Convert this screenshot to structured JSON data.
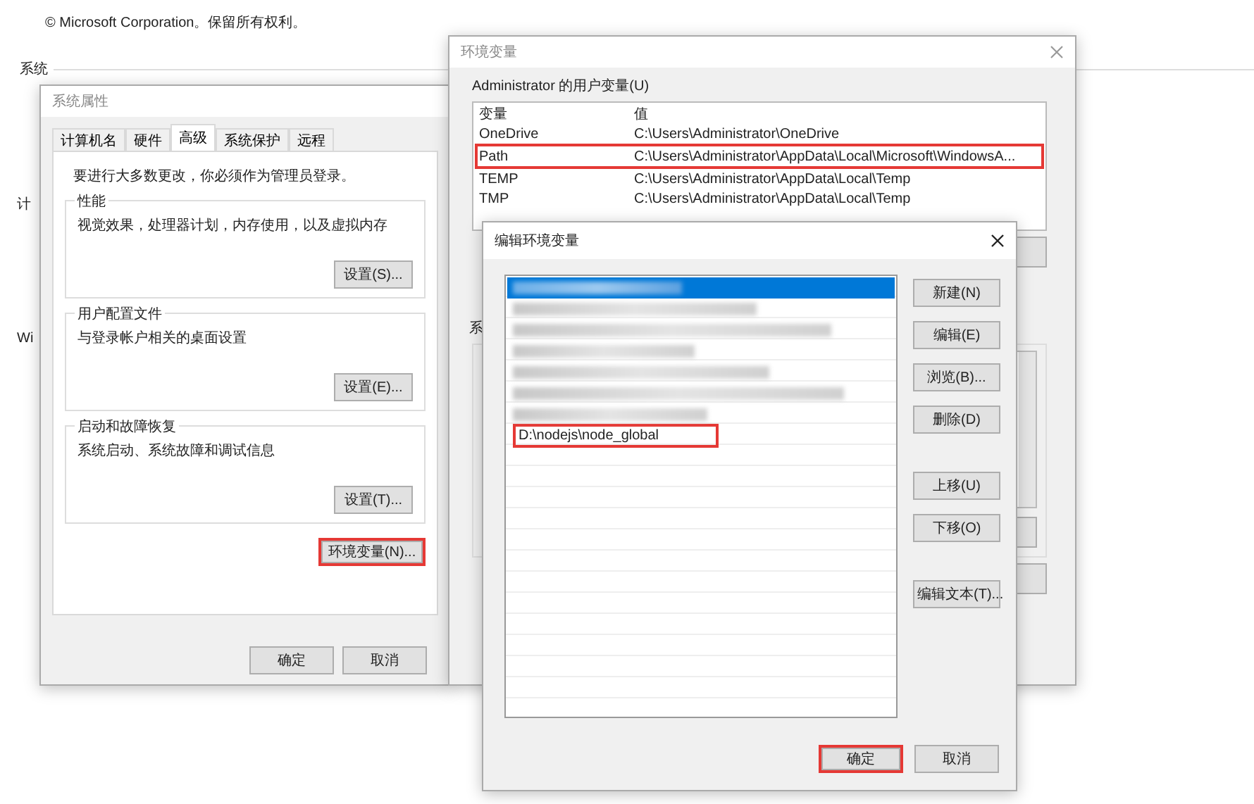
{
  "background": {
    "copyright": "© Microsoft Corporation。保留所有权利。",
    "section": "系统",
    "labels": [
      "计",
      "Wi"
    ]
  },
  "system_properties": {
    "title": "系统属性",
    "tabs": [
      {
        "label": "计算机名",
        "selected": false
      },
      {
        "label": "硬件",
        "selected": false
      },
      {
        "label": "高级",
        "selected": true
      },
      {
        "label": "系统保护",
        "selected": false
      },
      {
        "label": "远程",
        "selected": false
      }
    ],
    "notice": "要进行大多数更改，你必须作为管理员登录。",
    "groups": [
      {
        "title": "性能",
        "description": "视觉效果，处理器计划，内存使用，以及虚拟内存",
        "button": "设置(S)..."
      },
      {
        "title": "用户配置文件",
        "description": "与登录帐户相关的桌面设置",
        "button": "设置(E)..."
      },
      {
        "title": "启动和故障恢复",
        "description": "系统启动、系统故障和调试信息",
        "button": "设置(T)..."
      }
    ],
    "env_button": {
      "label": "环境变量(N)...",
      "highlighted": true
    },
    "buttons": [
      "确定",
      "取消"
    ]
  },
  "env_vars": {
    "title": "环境变量",
    "user_section": "Administrator 的用户变量(U)",
    "columns": [
      "变量",
      "值"
    ],
    "rows": [
      {
        "name": "OneDrive",
        "value": "C:\\Users\\Administrator\\OneDrive",
        "highlighted": false
      },
      {
        "name": "Path",
        "value": "C:\\Users\\Administrator\\AppData\\Local\\Microsoft\\WindowsA...",
        "highlighted": true
      },
      {
        "name": "TEMP",
        "value": "C:\\Users\\Administrator\\AppData\\Local\\Temp",
        "highlighted": false
      },
      {
        "name": "TMP",
        "value": "C:\\Users\\Administrator\\AppData\\Local\\Temp",
        "highlighted": false
      }
    ],
    "system_section": "系"
  },
  "edit_dialog": {
    "title": "编辑环境变量",
    "entries": [
      {
        "kind": "redacted",
        "selected": true
      },
      {
        "kind": "redacted",
        "selected": false
      },
      {
        "kind": "redacted",
        "selected": false
      },
      {
        "kind": "redacted",
        "selected": false
      },
      {
        "kind": "redacted",
        "selected": false
      },
      {
        "kind": "redacted",
        "selected": false
      },
      {
        "kind": "redacted",
        "selected": false
      },
      {
        "kind": "text",
        "text": "D:\\nodejs\\node_global",
        "selected": false,
        "highlighted": true
      }
    ],
    "side_button_groups": [
      [
        "新建(N)",
        "编辑(E)",
        "浏览(B)...",
        "删除(D)"
      ],
      [
        "上移(U)",
        "下移(O)"
      ],
      [
        "编辑文本(T)..."
      ]
    ],
    "buttons": [
      {
        "label": "确定",
        "highlighted": true
      },
      {
        "label": "取消",
        "highlighted": false
      }
    ]
  }
}
